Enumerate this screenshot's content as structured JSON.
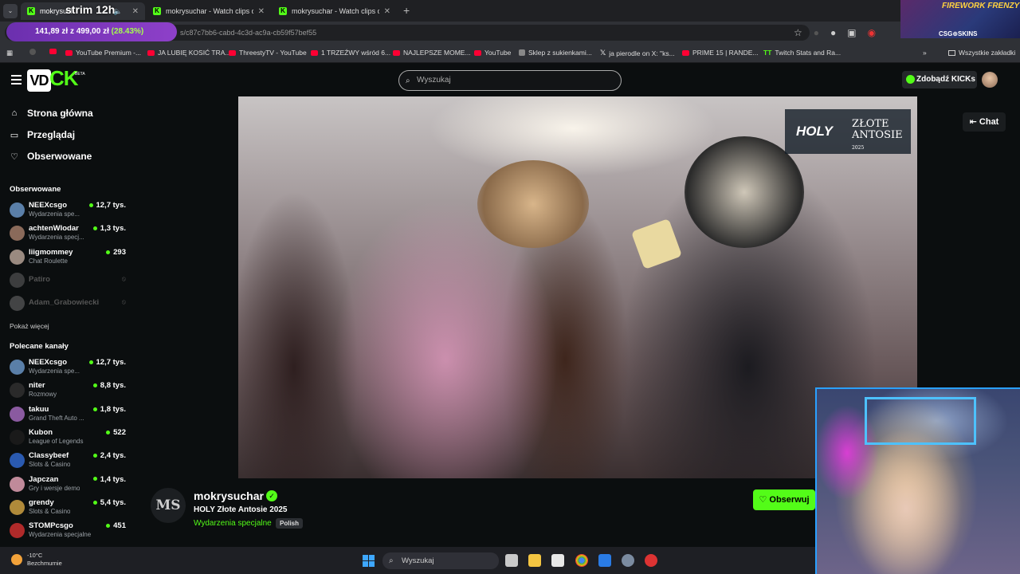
{
  "browser": {
    "tabs": [
      {
        "label": "mokrysuch",
        "active": true
      },
      {
        "label": "mokrysuchar - Watch clips on K",
        "active": false
      },
      {
        "label": "mokrysuchar - Watch clips on K",
        "active": false
      }
    ],
    "stream_overlay_text": "strim 12h",
    "url": "s/c87c7bb6-cabd-4c3d-ac9a-cb59f57bef55",
    "price_badge": {
      "amount": "141,89 zł",
      "connector": "z",
      "goal": "499,00 zł",
      "percent": "(28.43%)"
    },
    "bookmarks": [
      "YouTube Premium -...",
      "JA LUBIĘ KOSIĆ TRA...",
      "ThreestyTV - YouTube",
      "1 TRZEŹWY wśród 6...",
      "NAJLEPSZE MOME...",
      "YouTube",
      "Sklep z sukienkami...",
      "ja pierodle on X: \"ks...",
      "PRIME 15 | RANDE...",
      "Twitch Stats and Ra..."
    ],
    "all_bookmarks": "Wszystkie zakładki"
  },
  "overlay_top": {
    "title": "FIREWORK FRENZY",
    "brand": "CSG⊕SKINS"
  },
  "header": {
    "logo_prefix": "VD",
    "logo_text": "CK",
    "beta": "BETA",
    "search_placeholder": "Wyszukaj",
    "kicks_button": "Zdobądź KICKs"
  },
  "sidebar": {
    "nav": [
      {
        "label": "Strona główna",
        "icon": "home-icon"
      },
      {
        "label": "Przeglądaj",
        "icon": "browse-icon"
      },
      {
        "label": "Obserwowane",
        "icon": "heart-icon"
      }
    ],
    "followed_title": "Obserwowane",
    "followed": [
      {
        "name": "NEEXcsgo",
        "category": "Wydarzenia spe...",
        "viewers": "12,7 tys.",
        "color": "#5a7fa8"
      },
      {
        "name": "achtenWlodar",
        "category": "Wydarzenia specj...",
        "viewers": "1,3 tys.",
        "color": "#8a6a5a"
      },
      {
        "name": "liigmommey",
        "category": "Chat Roulette",
        "viewers": "293",
        "color": "#9a8a80"
      },
      {
        "name": "Patiro",
        "category": "",
        "viewers": "",
        "offline": true,
        "color": "#777"
      },
      {
        "name": "Adam_Grabowiecki",
        "category": "",
        "viewers": "",
        "offline": true,
        "color": "#888"
      }
    ],
    "show_more": "Pokaż więcej",
    "recommended_title": "Polecane kanały",
    "recommended": [
      {
        "name": "NEEXcsgo",
        "category": "Wydarzenia spe...",
        "viewers": "12,7 tys.",
        "color": "#5a7fa8"
      },
      {
        "name": "niter",
        "category": "Rozmowy",
        "viewers": "8,8 tys.",
        "color": "#2a2a2a"
      },
      {
        "name": "takuu",
        "category": "Grand Theft Auto ...",
        "viewers": "1,8 tys.",
        "color": "#8a5aa0"
      },
      {
        "name": "Kubon",
        "category": "League of Legends",
        "viewers": "522",
        "color": "#1a1a1a"
      },
      {
        "name": "Classybeef",
        "category": "Slots & Casino",
        "viewers": "2,4 tys.",
        "color": "#2a5ab0"
      },
      {
        "name": "Japczan",
        "category": "Gry i wersje demo",
        "viewers": "1,4 tys.",
        "color": "#c08a9a"
      },
      {
        "name": "grendy",
        "category": "Slots & Casino",
        "viewers": "5,4 tys.",
        "color": "#b08a3a"
      },
      {
        "name": "STOMPcsgo",
        "category": "Wydarzenia specjalne",
        "viewers": "451",
        "color": "#b02a2a"
      }
    ]
  },
  "video": {
    "overlay_logo": "HOLY",
    "overlay_event_line1": "ZŁOTE",
    "overlay_event_line2": "ANTOSIE",
    "overlay_year": "2025",
    "chat_button": "Chat"
  },
  "stream": {
    "avatar_initials": "MS",
    "streamer": "mokrysuchar",
    "title": "HOLY Złote Antosie 2025",
    "category": "Wydarzenia specjalne",
    "language": "Polish",
    "follow_button": "Obserwuj"
  },
  "taskbar": {
    "temperature": "-10°C",
    "weather": "Bezchmurnie",
    "search": "Wyszukaj"
  }
}
